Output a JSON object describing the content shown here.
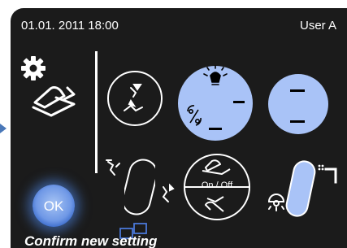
{
  "header": {
    "datetime": "01.01. 2011 18:00",
    "user": "User A"
  },
  "icons": {
    "settings": "gear-icon",
    "pedal": "foot-pedal-icon",
    "chair": "chair-positions-icon",
    "light": "lamp-icon",
    "percent": "percent-icon",
    "pedal_onoff": "pedal-on-off-icon",
    "lamp": "operating-lamp-icon",
    "spittoon": "spittoon-icon"
  },
  "pedal_control": {
    "label": "On / Off"
  },
  "ok_button": {
    "label": "OK"
  },
  "footer": {
    "message": "Confirm new setting"
  },
  "colors": {
    "active": "#a9c3f7",
    "background": "#1b1b1b",
    "ok_glow": "#5a8ee6"
  }
}
